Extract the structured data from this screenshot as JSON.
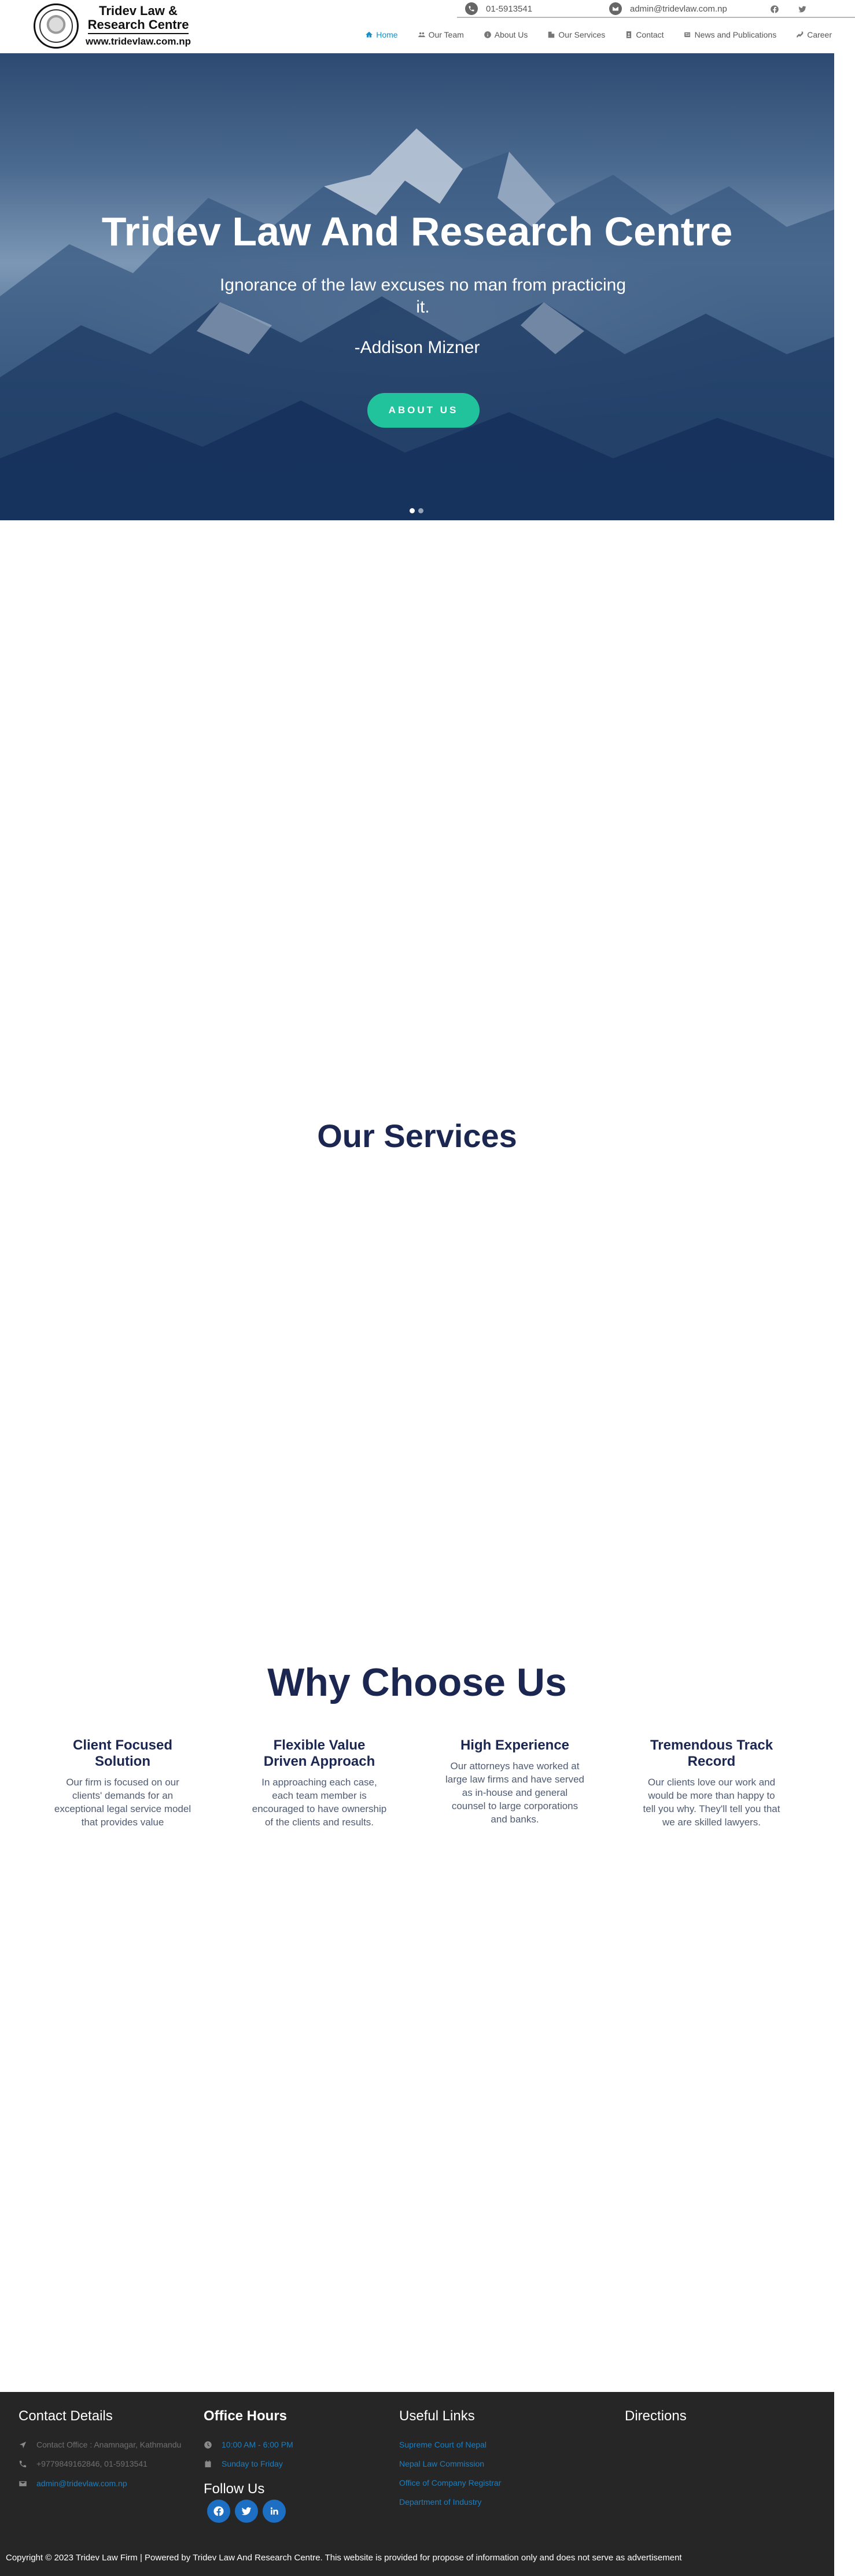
{
  "topbar": {
    "phone": "01-5913541",
    "email": "admin@tridevlaw.com.np",
    "social_icons": [
      "facebook-icon",
      "twitter-icon"
    ]
  },
  "logo": {
    "line1": "Tridev Law &",
    "line2": "Research Centre",
    "line3": "www.tridevlaw.com.np"
  },
  "nav": {
    "items": [
      {
        "label": "Home",
        "icon": "home-icon",
        "active": true
      },
      {
        "label": "Our Team",
        "icon": "team-icon",
        "active": false
      },
      {
        "label": "About Us",
        "icon": "info-icon",
        "active": false
      },
      {
        "label": "Our Services",
        "icon": "building-icon",
        "active": false
      },
      {
        "label": "Contact",
        "icon": "contact-icon",
        "active": false
      },
      {
        "label": "News and Publications",
        "icon": "newspaper-icon",
        "active": false
      },
      {
        "label": "Career",
        "icon": "career-icon",
        "active": false
      }
    ]
  },
  "hero": {
    "title": "Tridev Law And Research Centre",
    "quote": "Ignorance of the law excuses no man from practicing it.",
    "author": "-Addison Mizner",
    "button": "ABOUT US",
    "slides": 2,
    "active_slide": 1
  },
  "services": {
    "title": "Our Services"
  },
  "why": {
    "title": "Why Choose Us",
    "features": [
      {
        "title": "Client Focused Solution",
        "text": "Our firm is focused on our clients' demands for an exceptional legal service model that provides value"
      },
      {
        "title": "Flexible Value Driven Approach",
        "text": "In approaching each case, each team member is encouraged to have ownership of the clients and results."
      },
      {
        "title": "High Experience",
        "text": "Our attorneys have worked at large law firms and have served as in-house and general counsel to large corporations and banks."
      },
      {
        "title": "Tremendous Track Record",
        "text": "Our clients love our work and would be more than happy to tell you why. They'll tell you that we are skilled lawyers."
      }
    ]
  },
  "footer": {
    "contact": {
      "title": "Contact Details",
      "address": "Contact Office : Anamnagar, Kathmandu",
      "phone": "+9779849162846, 01-5913541",
      "email": "admin@tridevlaw.com.np"
    },
    "hours": {
      "title": "Office Hours",
      "time": "10:00 AM - 6:00 PM",
      "days": "Sunday to Friday",
      "follow": "Follow Us",
      "social_icons": [
        "facebook-icon",
        "twitter-icon",
        "linkedin-icon"
      ]
    },
    "links": {
      "title": "Useful Links",
      "items": [
        "Supreme Court of Nepal",
        "Nepal Law Commission",
        "Office of Company Registrar",
        "Department of Industry"
      ]
    },
    "directions": {
      "title": "Directions"
    },
    "copyright": "Copyright © 2023 Tridev Law Firm | Powered by Tridev Law And Research Centre. This website is provided for propose of information only and does not serve as advertisement"
  },
  "colors": {
    "accent": "#20c39b",
    "navy": "#1c2751",
    "nav_active": "#1a8fc6",
    "footer_bg": "#262626",
    "link": "#1a7fc0"
  }
}
